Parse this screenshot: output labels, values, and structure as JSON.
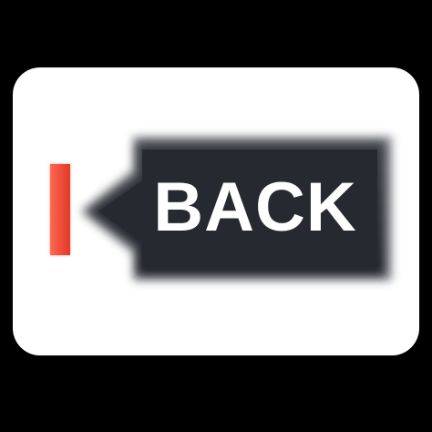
{
  "back_button": {
    "label": "BACK",
    "icon": "back-arrow-tag-icon",
    "fill_color": "#2c2f36",
    "text_color": "#ffffff"
  },
  "indicator": {
    "color": "#f1533e"
  },
  "card": {
    "background": "#ffffff"
  },
  "page": {
    "background": "#000000"
  }
}
